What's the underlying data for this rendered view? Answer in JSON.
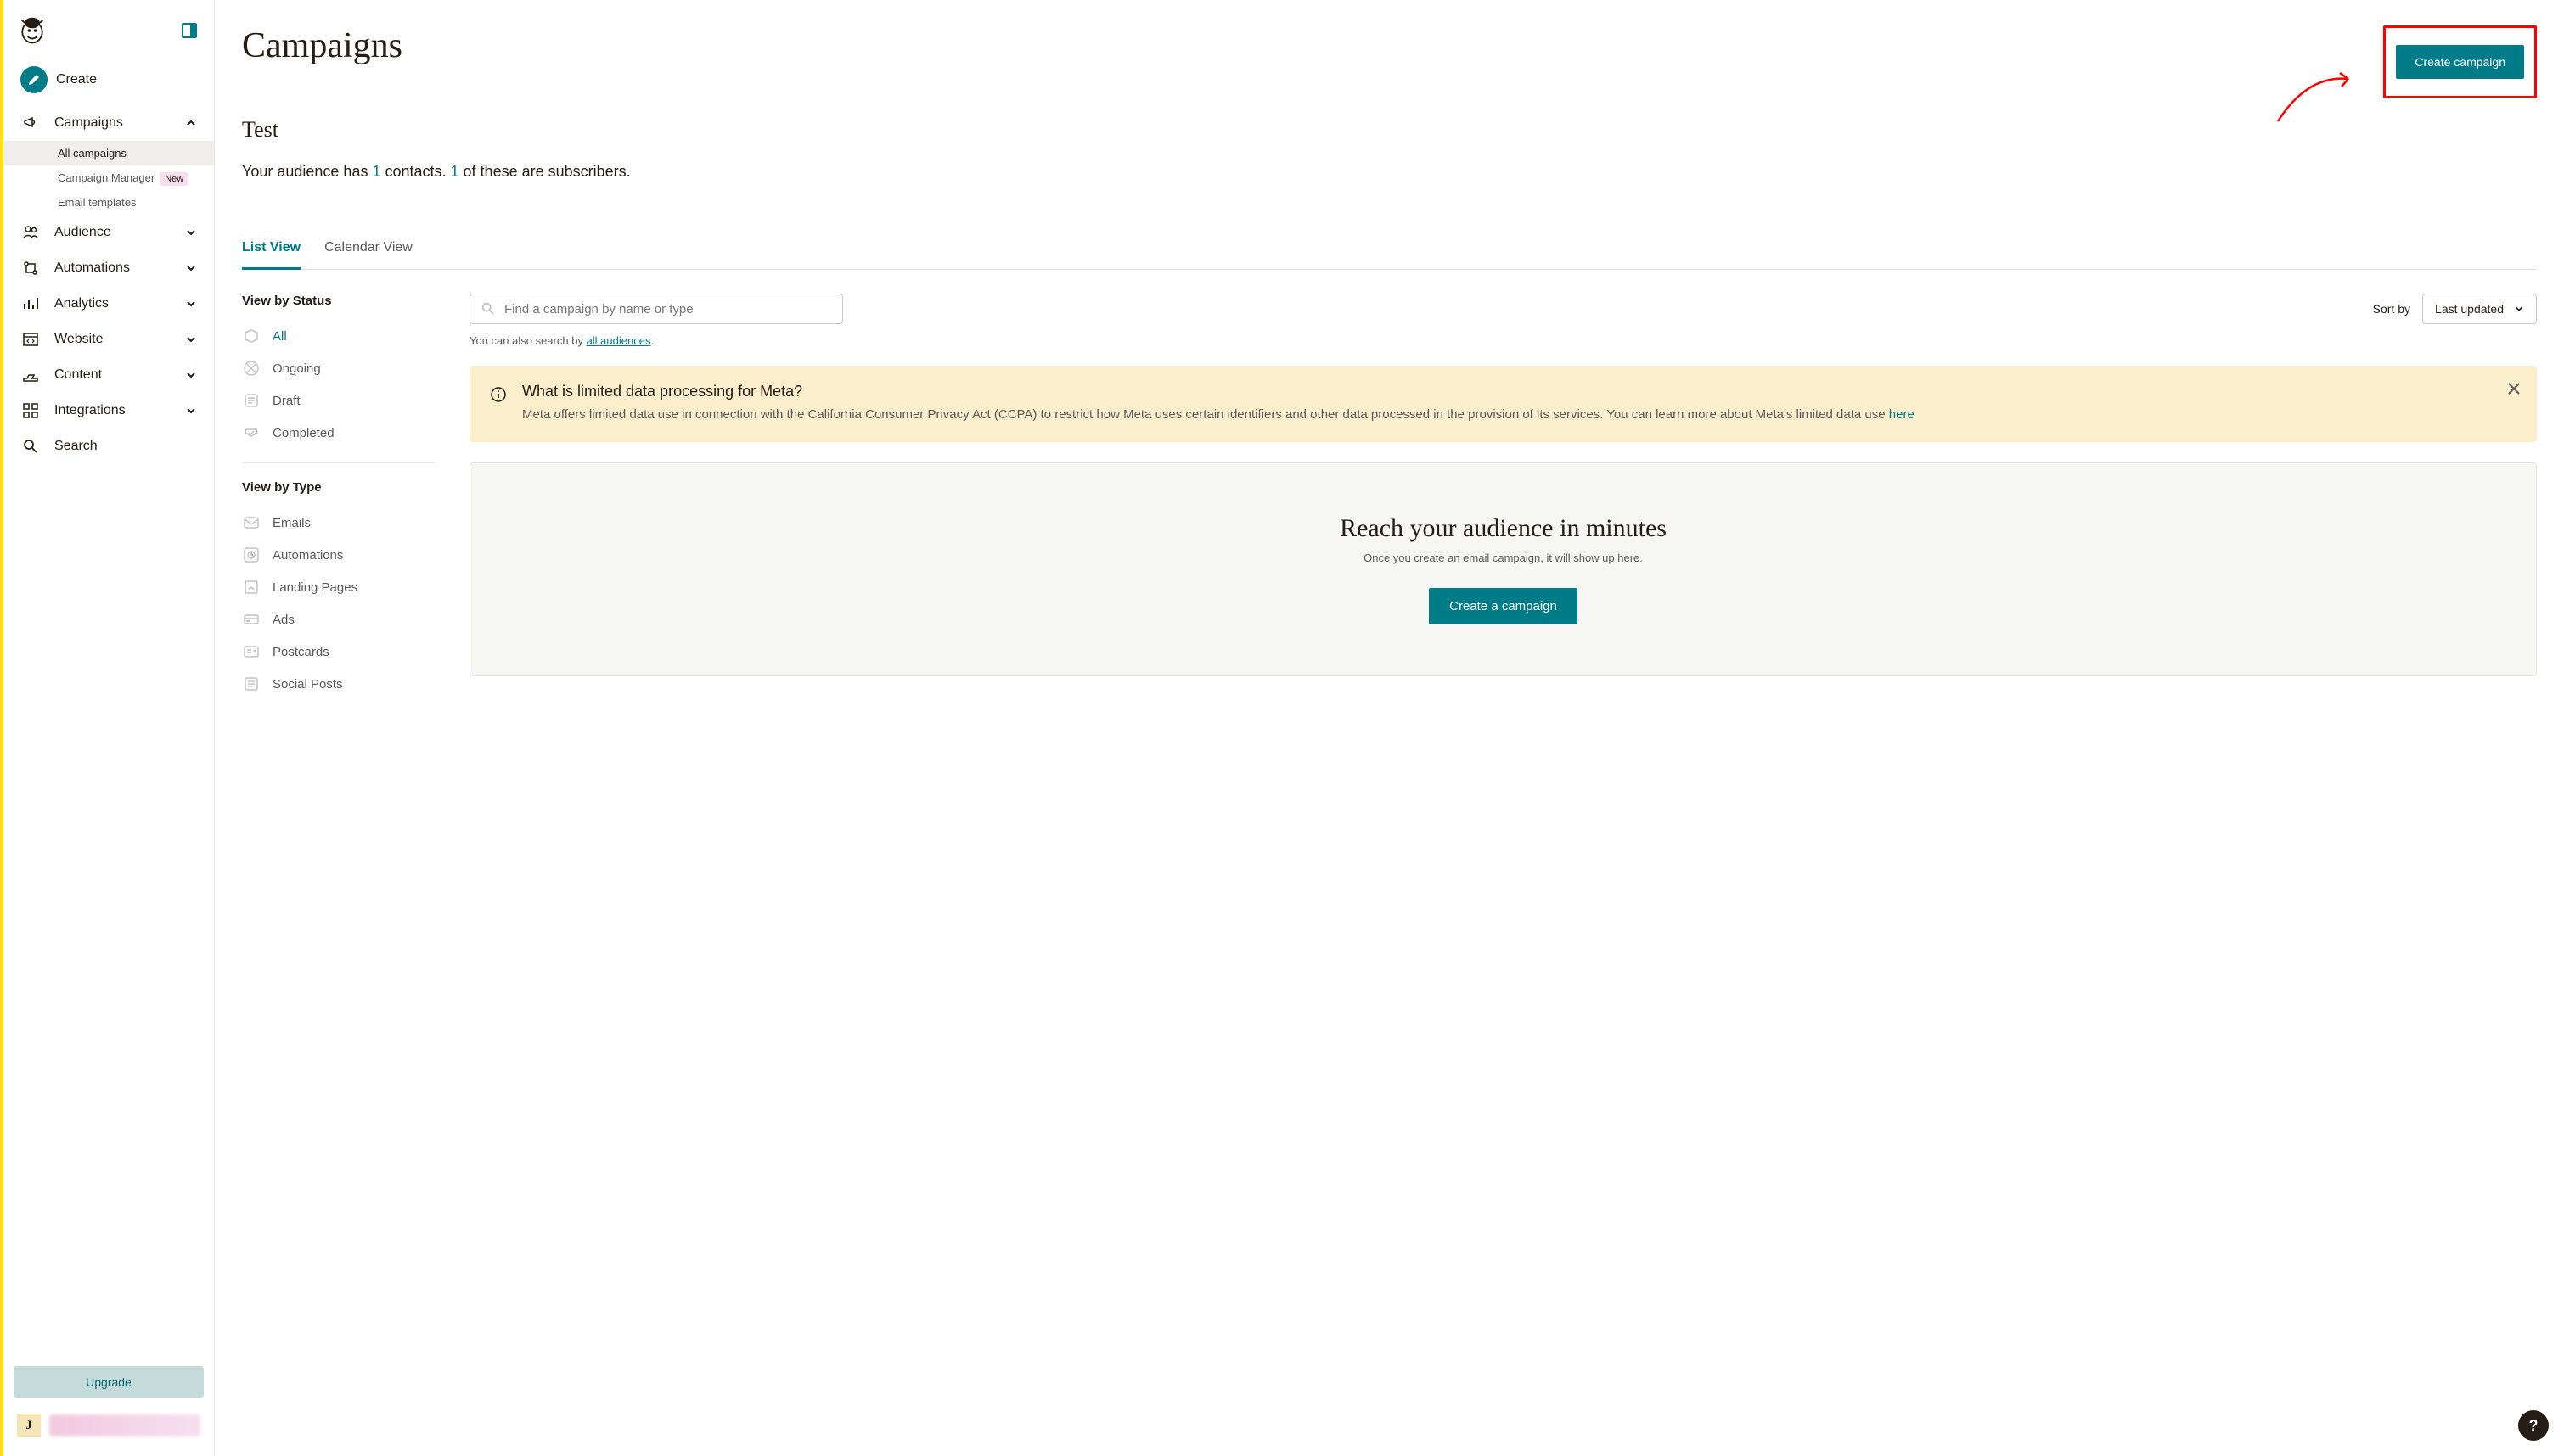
{
  "sidebar": {
    "create_label": "Create",
    "items": [
      {
        "label": "Campaigns",
        "expanded": true,
        "sub": [
          {
            "label": "All campaigns",
            "active": true
          },
          {
            "label": "Campaign Manager",
            "badge": "New"
          },
          {
            "label": "Email templates"
          }
        ]
      },
      {
        "label": "Audience"
      },
      {
        "label": "Automations"
      },
      {
        "label": "Analytics"
      },
      {
        "label": "Website"
      },
      {
        "label": "Content"
      },
      {
        "label": "Integrations"
      },
      {
        "label": "Search"
      }
    ],
    "upgrade_label": "Upgrade",
    "user_initial": "J"
  },
  "header": {
    "page_title": "Campaigns",
    "create_button": "Create campaign",
    "sub_title": "Test",
    "audience_prefix": "Your audience has ",
    "audience_count": "1",
    "audience_mid": " contacts. ",
    "subscriber_count": "1",
    "audience_suffix": " of these are subscribers."
  },
  "tabs": {
    "list": "List View",
    "calendar": "Calendar View"
  },
  "filters": {
    "status_heading": "View by Status",
    "status": [
      {
        "label": "All",
        "active": true
      },
      {
        "label": "Ongoing"
      },
      {
        "label": "Draft"
      },
      {
        "label": "Completed"
      }
    ],
    "type_heading": "View by Type",
    "type": [
      {
        "label": "Emails"
      },
      {
        "label": "Automations"
      },
      {
        "label": "Landing Pages"
      },
      {
        "label": "Ads"
      },
      {
        "label": "Postcards"
      },
      {
        "label": "Social Posts"
      }
    ]
  },
  "search": {
    "placeholder": "Find a campaign by name or type",
    "hint_prefix": "You can also search by ",
    "hint_link": "all audiences",
    "hint_suffix": "."
  },
  "sort": {
    "label": "Sort by",
    "selected": "Last updated"
  },
  "notice": {
    "title": "What is limited data processing for Meta?",
    "body": "Meta offers limited data use in connection with the California Consumer Privacy Act (CCPA) to restrict how Meta uses certain identifiers and other data processed in the provision of its services. You can learn more about Meta's limited data use ",
    "link": "here"
  },
  "empty": {
    "title": "Reach your audience in minutes",
    "sub": "Once you create an email campaign, it will show up here.",
    "button": "Create a campaign"
  },
  "help_fab": "?"
}
